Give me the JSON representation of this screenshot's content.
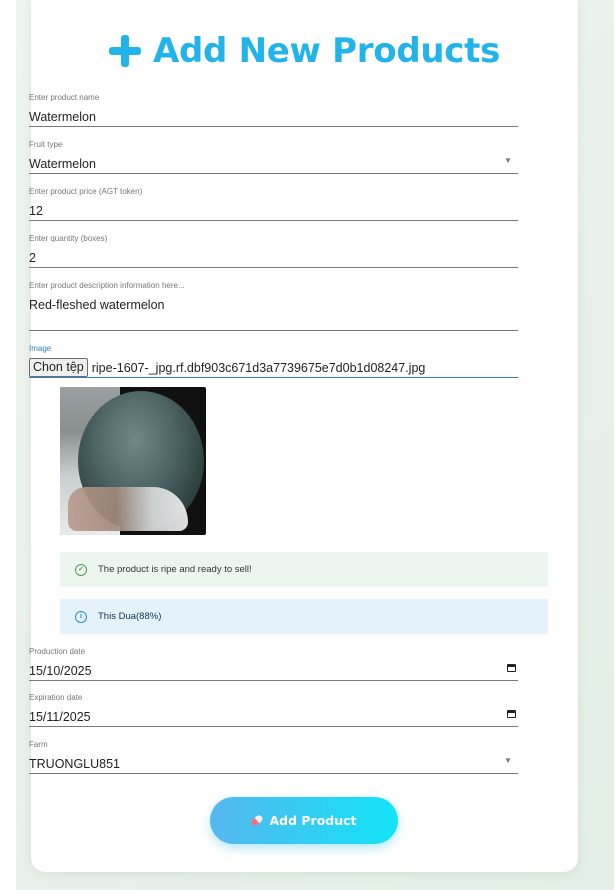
{
  "form": {
    "title": "Add New Products",
    "product_name": {
      "label": "Enter product name",
      "value": "Watermelon"
    },
    "fruit_type": {
      "label": "Fruit type",
      "value": "Watermelon"
    },
    "price": {
      "label": "Enter product price (AGT token)",
      "value": "12"
    },
    "quantity": {
      "label": "Enter quantity (boxes)",
      "value": "2"
    },
    "description": {
      "label": "Enter product description information here...",
      "value": "Red-fleshed watermelon"
    },
    "image": {
      "label": "Image",
      "button_label": "Chon tệp",
      "file_name": "ripe-1607-_jpg.rf.dbf903c671d3a7739675e7d0b1d08247.jpg"
    },
    "alerts": {
      "success": "The product is ripe and ready to sell!",
      "info": "This Dua(88%)"
    },
    "production_date": {
      "label": "Production date",
      "value": "15/10/2025"
    },
    "expiration_date": {
      "label": "Expiration date",
      "value": "15/11/2025"
    },
    "farm": {
      "label": "Farm",
      "value": "TRUONGLU851"
    },
    "submit_label": "Add Product"
  },
  "icons": {
    "title": "plus-icon",
    "dropdown": "caret-down-icon",
    "date": "calendar-icon",
    "success": "check-circle-icon",
    "info": "info-circle-icon",
    "submit": "pill-icon"
  },
  "colors": {
    "accent": "#22b3ea",
    "success_bg": "#edf6ee",
    "info_bg": "#e4f3fb"
  }
}
